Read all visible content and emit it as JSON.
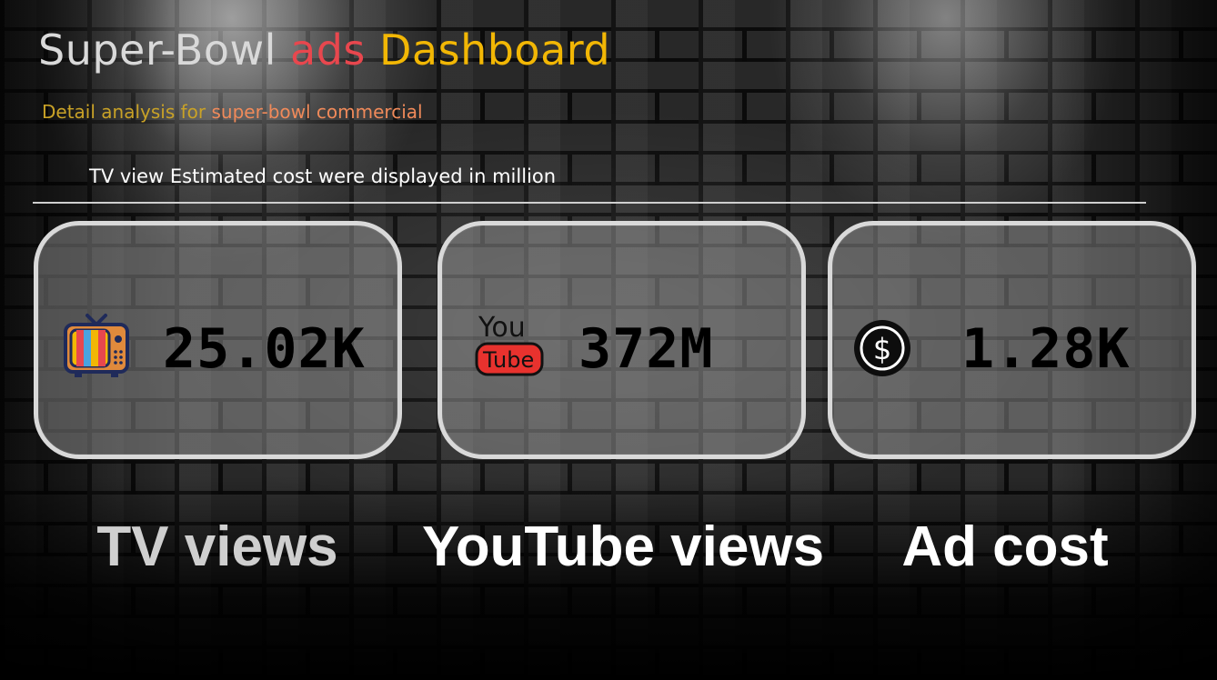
{
  "header": {
    "title_part1": "Super-Bowl",
    "title_part2": "ads",
    "title_part3": "Dashboard",
    "subtitle_part1": "Detail analysis for",
    "subtitle_part2": "super-bowl commercial",
    "note": "TV view Estimated cost were displayed in million"
  },
  "colors": {
    "title_part1": "#d9d9d9",
    "title_part2": "#e8474e",
    "title_part3": "#f2b705",
    "subtitle_part1": "#c9a227",
    "subtitle_part2": "#f08a5a",
    "note": "#ffffff",
    "kpi_value": "#000000",
    "kpi_label_tv": "#cfcfcf",
    "kpi_label": "#ffffff"
  },
  "kpis": [
    {
      "value": "25.02K",
      "label": "TV views",
      "icon": "tv-icon"
    },
    {
      "value": "372M",
      "label": "YouTube views",
      "icon": "youtube-icon"
    },
    {
      "value": "1.28K",
      "label": "Ad cost",
      "icon": "dollar-coin-icon"
    }
  ]
}
